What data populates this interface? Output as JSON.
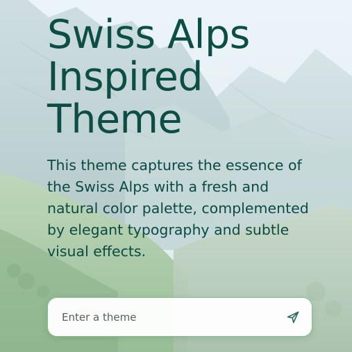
{
  "hero": {
    "title": "Swiss Alps Inspired Theme",
    "description": "This theme captures the essence of the Swiss Alps with a fresh and natural color palette, complemented by elegant typography and subtle visual effects."
  },
  "theme_input": {
    "placeholder": "Enter a theme",
    "value": "",
    "submit_icon": "send-icon"
  },
  "colors": {
    "title": "#0c4e45",
    "text": "#0b4a40",
    "input_border": "#7fc08c",
    "accent": "#2d6b5f"
  }
}
